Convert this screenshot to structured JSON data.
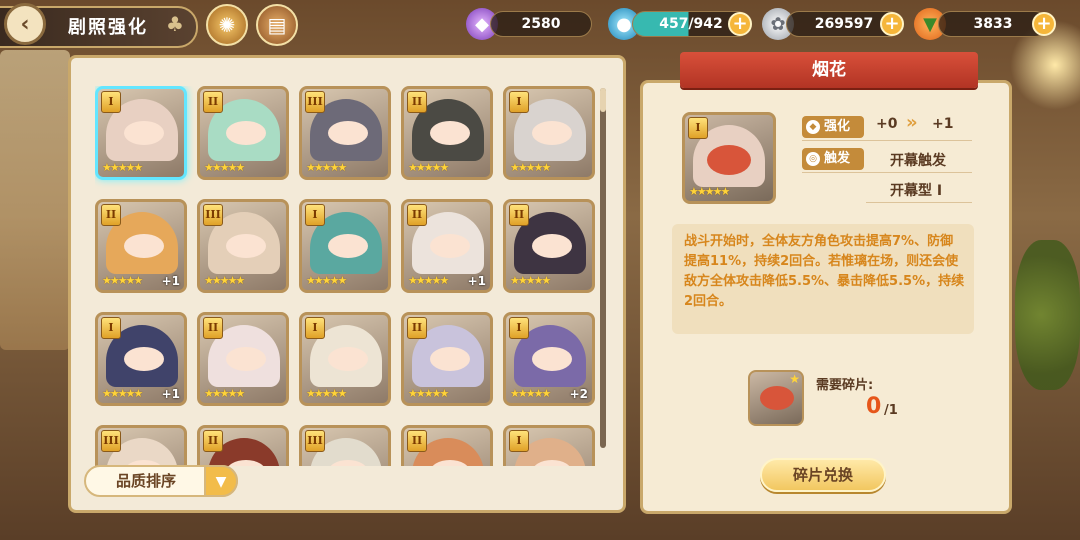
{
  "header": {
    "title": "剧照强化",
    "back_icon": "back-arrow-icon",
    "title_icon": "clover-icon",
    "shortcut_icons": [
      "compass-medal-icon",
      "book-icon"
    ]
  },
  "resources": [
    {
      "id": "crystal",
      "icon": "purple-crystal-icon",
      "value": "2580",
      "has_plus": false
    },
    {
      "id": "stamina",
      "icon": "potion-icon",
      "value": "457/942",
      "has_plus": true
    },
    {
      "id": "coin",
      "icon": "silver-coin-icon",
      "value": "269597",
      "has_plus": true
    },
    {
      "id": "carrot",
      "icon": "carrot-icon",
      "value": "3833",
      "has_plus": true
    }
  ],
  "cards": [
    {
      "rank": "I",
      "stars": "★★★★★",
      "bonus": "",
      "selected": true,
      "tone": "#e8d0c2"
    },
    {
      "rank": "II",
      "stars": "★★★★★",
      "bonus": "",
      "selected": false,
      "tone": "#a9dcc4"
    },
    {
      "rank": "III",
      "stars": "★★★★★",
      "bonus": "",
      "selected": false,
      "tone": "#6d6a78"
    },
    {
      "rank": "II",
      "stars": "★★★★★",
      "bonus": "",
      "selected": false,
      "tone": "#4b4a44"
    },
    {
      "rank": "I",
      "stars": "★★★★★",
      "bonus": "",
      "selected": false,
      "tone": "#d9d3cf"
    },
    {
      "rank": "II",
      "stars": "★★★★★",
      "bonus": "+1",
      "selected": false,
      "tone": "#e6a85a"
    },
    {
      "rank": "III",
      "stars": "★★★★★",
      "bonus": "",
      "selected": false,
      "tone": "#e4cfb8"
    },
    {
      "rank": "I",
      "stars": "★★★★★",
      "bonus": "",
      "selected": false,
      "tone": "#5aa8a0"
    },
    {
      "rank": "II",
      "stars": "★★★★★",
      "bonus": "+1",
      "selected": false,
      "tone": "#ece3dc"
    },
    {
      "rank": "II",
      "stars": "★★★★★",
      "bonus": "",
      "selected": false,
      "tone": "#3e3442"
    },
    {
      "rank": "I",
      "stars": "★★★★★",
      "bonus": "+1",
      "selected": false,
      "tone": "#40436a"
    },
    {
      "rank": "II",
      "stars": "★★★★★",
      "bonus": "",
      "selected": false,
      "tone": "#efe0de"
    },
    {
      "rank": "I",
      "stars": "★★★★★",
      "bonus": "",
      "selected": false,
      "tone": "#ede4d4"
    },
    {
      "rank": "II",
      "stars": "★★★★★",
      "bonus": "",
      "selected": false,
      "tone": "#c9c3dc"
    },
    {
      "rank": "I",
      "stars": "★★★★★",
      "bonus": "+2",
      "selected": false,
      "tone": "#7b6aa8"
    },
    {
      "rank": "III",
      "stars": "",
      "bonus": "",
      "selected": false,
      "tone": "#ead8c6"
    },
    {
      "rank": "II",
      "stars": "",
      "bonus": "",
      "selected": false,
      "tone": "#8a3a2a"
    },
    {
      "rank": "III",
      "stars": "",
      "bonus": "",
      "selected": false,
      "tone": "#e2dccd"
    },
    {
      "rank": "II",
      "stars": "",
      "bonus": "",
      "selected": false,
      "tone": "#d98c5a"
    },
    {
      "rank": "I",
      "stars": "",
      "bonus": "",
      "selected": false,
      "tone": "#e0b08a"
    }
  ],
  "sort": {
    "label": "品质排序",
    "arrow_icon": "chevron-down-icon"
  },
  "detail": {
    "name": "烟花",
    "portrait_rank": "I",
    "portrait_stars": "★★★★★",
    "enhance_label": "强化",
    "enhance_from": "+0",
    "enhance_arrow": "»",
    "enhance_to": "+1",
    "trigger_label": "触发",
    "trigger_value": "开幕触发",
    "type_value": "开幕型 I",
    "description": "战斗开始时，全体友方角色攻击提高7%、防御提高11%，持续2回合。若惟璃在场，则还会使敌方全体攻击降低5.5%、暴击降低5.5%，持续2回合。",
    "fragments_label": "需要碎片:",
    "fragments_have": "0",
    "fragments_need": "/1",
    "exchange_label": "碎片兑换"
  }
}
